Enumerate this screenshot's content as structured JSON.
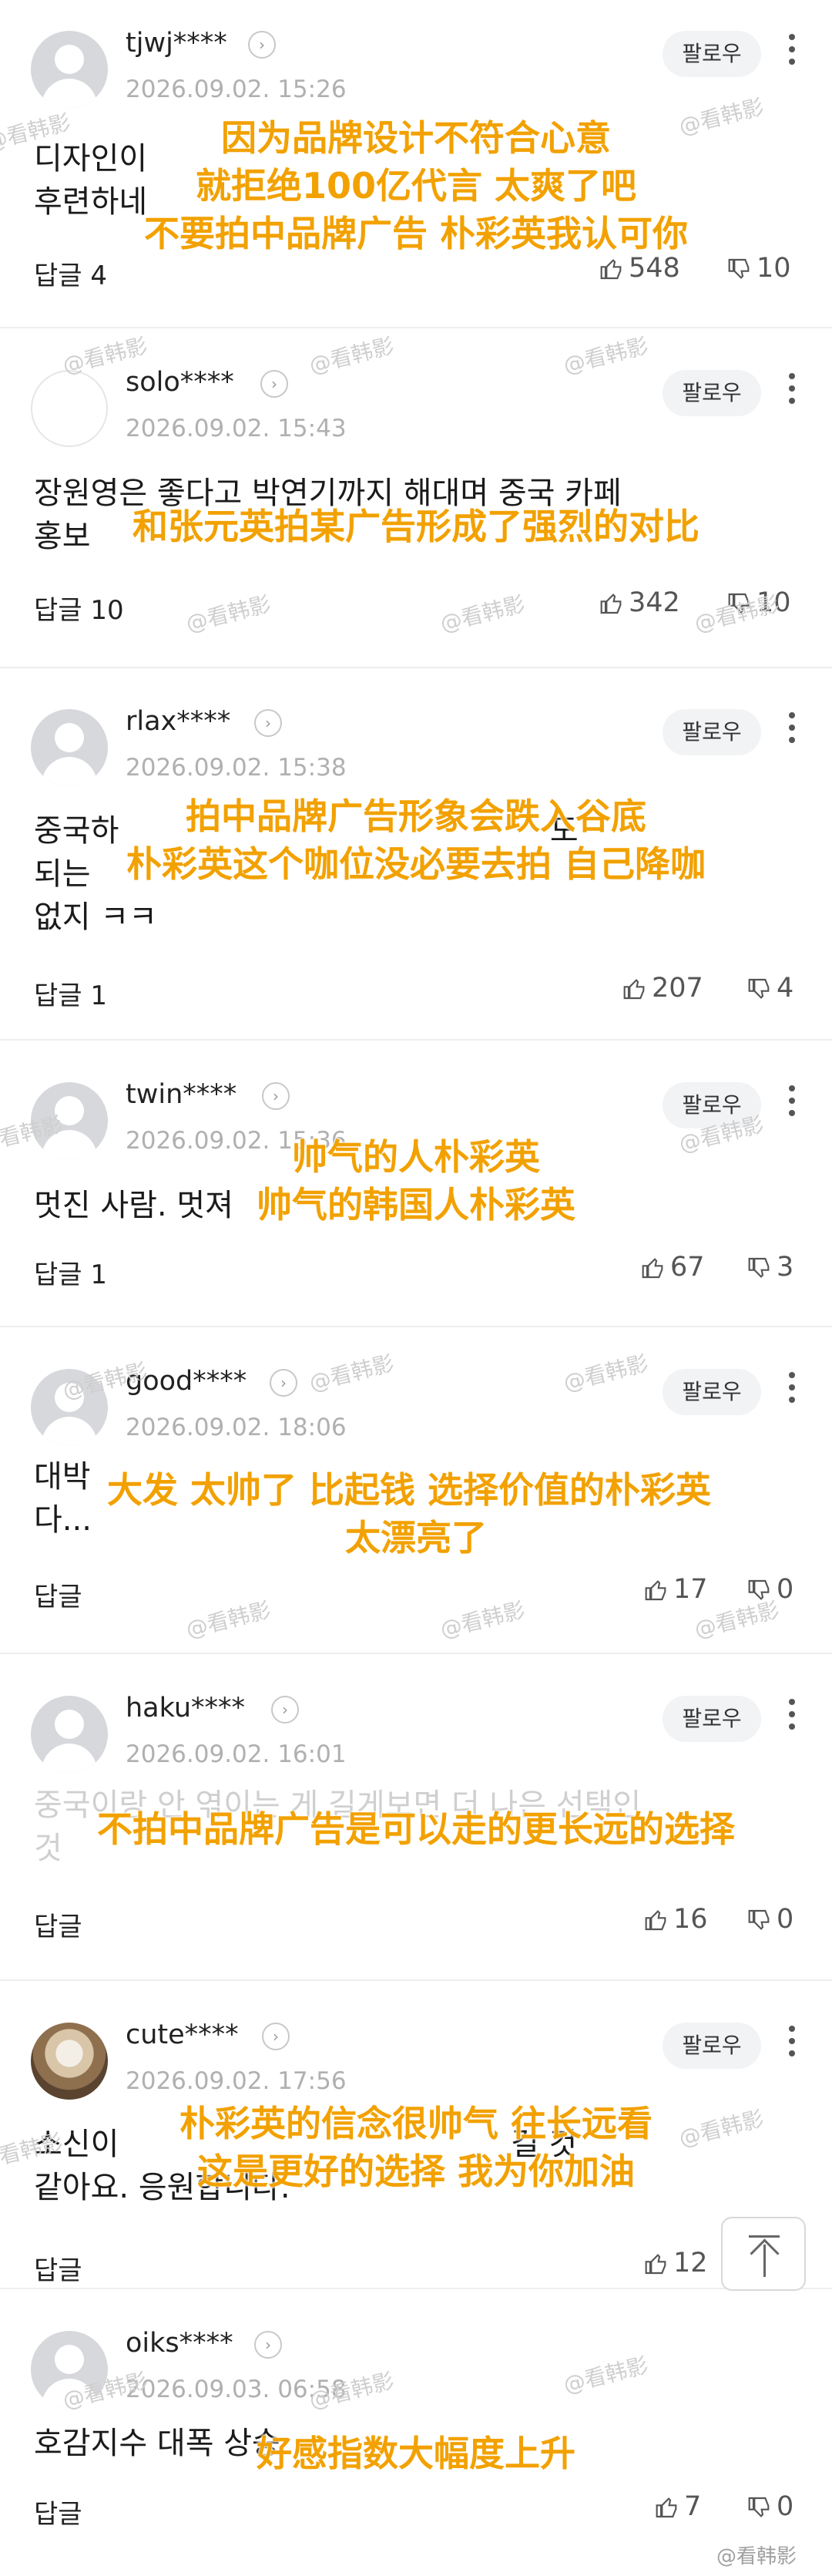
{
  "follow_label": "팔로우",
  "reply_label_prefix": "답글",
  "watermark": "@看韩影",
  "footer_watermark": "@看韩影",
  "comments": [
    {
      "user": "tjwj****",
      "time": "2026.09.02. 15:26",
      "text": "디자인이\n후련하네",
      "reply": "답글 4",
      "likes": "548",
      "dislikes": "10",
      "overlay": [
        "因为品牌设计不符合心意",
        "就拒绝100亿代言 太爽了吧",
        "不要拍中品牌广告 朴彩英我认可你"
      ]
    },
    {
      "user": "solo****",
      "time": "2026.09.02. 15:43",
      "text": "장원영은 좋다고 박연기까지 해대며 중국 카페\n홍보",
      "reply": "답글 10",
      "likes": "342",
      "dislikes": "10",
      "overlay": [
        "和张元英拍某广告形成了强烈的对比"
      ]
    },
    {
      "user": "rlax****",
      "time": "2026.09.02. 15:38",
      "text": "중국하                                            도\n되는\n없지 ㅋㅋ",
      "reply": "답글 1",
      "likes": "207",
      "dislikes": "4",
      "overlay": [
        "拍中品牌广告形象会跌入谷底",
        "朴彩英这个咖位没必要去拍 自己降咖"
      ]
    },
    {
      "user": "twin****",
      "time": "2026.09.02. 15:36",
      "text": "멋진 사람. 멋져",
      "reply": "답글 1",
      "likes": "67",
      "dislikes": "3",
      "overlay": [
        "帅气的人朴彩英",
        "帅气的韩国人朴彩英"
      ]
    },
    {
      "user": "good****",
      "time": "2026.09.02. 18:06",
      "text": "대박\n다...",
      "reply": "답글",
      "likes": "17",
      "dislikes": "0",
      "overlay": [
        "大发 太帅了 比起钱 选择价值的朴彩英",
        "太漂亮了"
      ]
    },
    {
      "user": "haku****",
      "time": "2026.09.02. 16:01",
      "text": "중국이랑 안 엮이는 게 길게보면 더 나은 선택인\n것",
      "reply": "답글",
      "likes": "16",
      "dislikes": "0",
      "overlay": [
        "不拍中品牌广告是可以走的更长远的选择"
      ]
    },
    {
      "user": "cute****",
      "time": "2026.09.02. 17:56",
      "text": "소신이                                        길 것\n같아요. 응원합니다.",
      "reply": "답글",
      "likes": "12",
      "dislikes": "",
      "overlay": [
        "朴彩英的信念很帅气 往长远看",
        "这是更好的选择 我为你加油"
      ]
    },
    {
      "user": "oiks****",
      "time": "2026.09.03. 06:58",
      "text": "호감지수 대폭 상승",
      "reply": "답글",
      "likes": "7",
      "dislikes": "0",
      "overlay": [
        "好感指数大幅度上升"
      ]
    }
  ]
}
